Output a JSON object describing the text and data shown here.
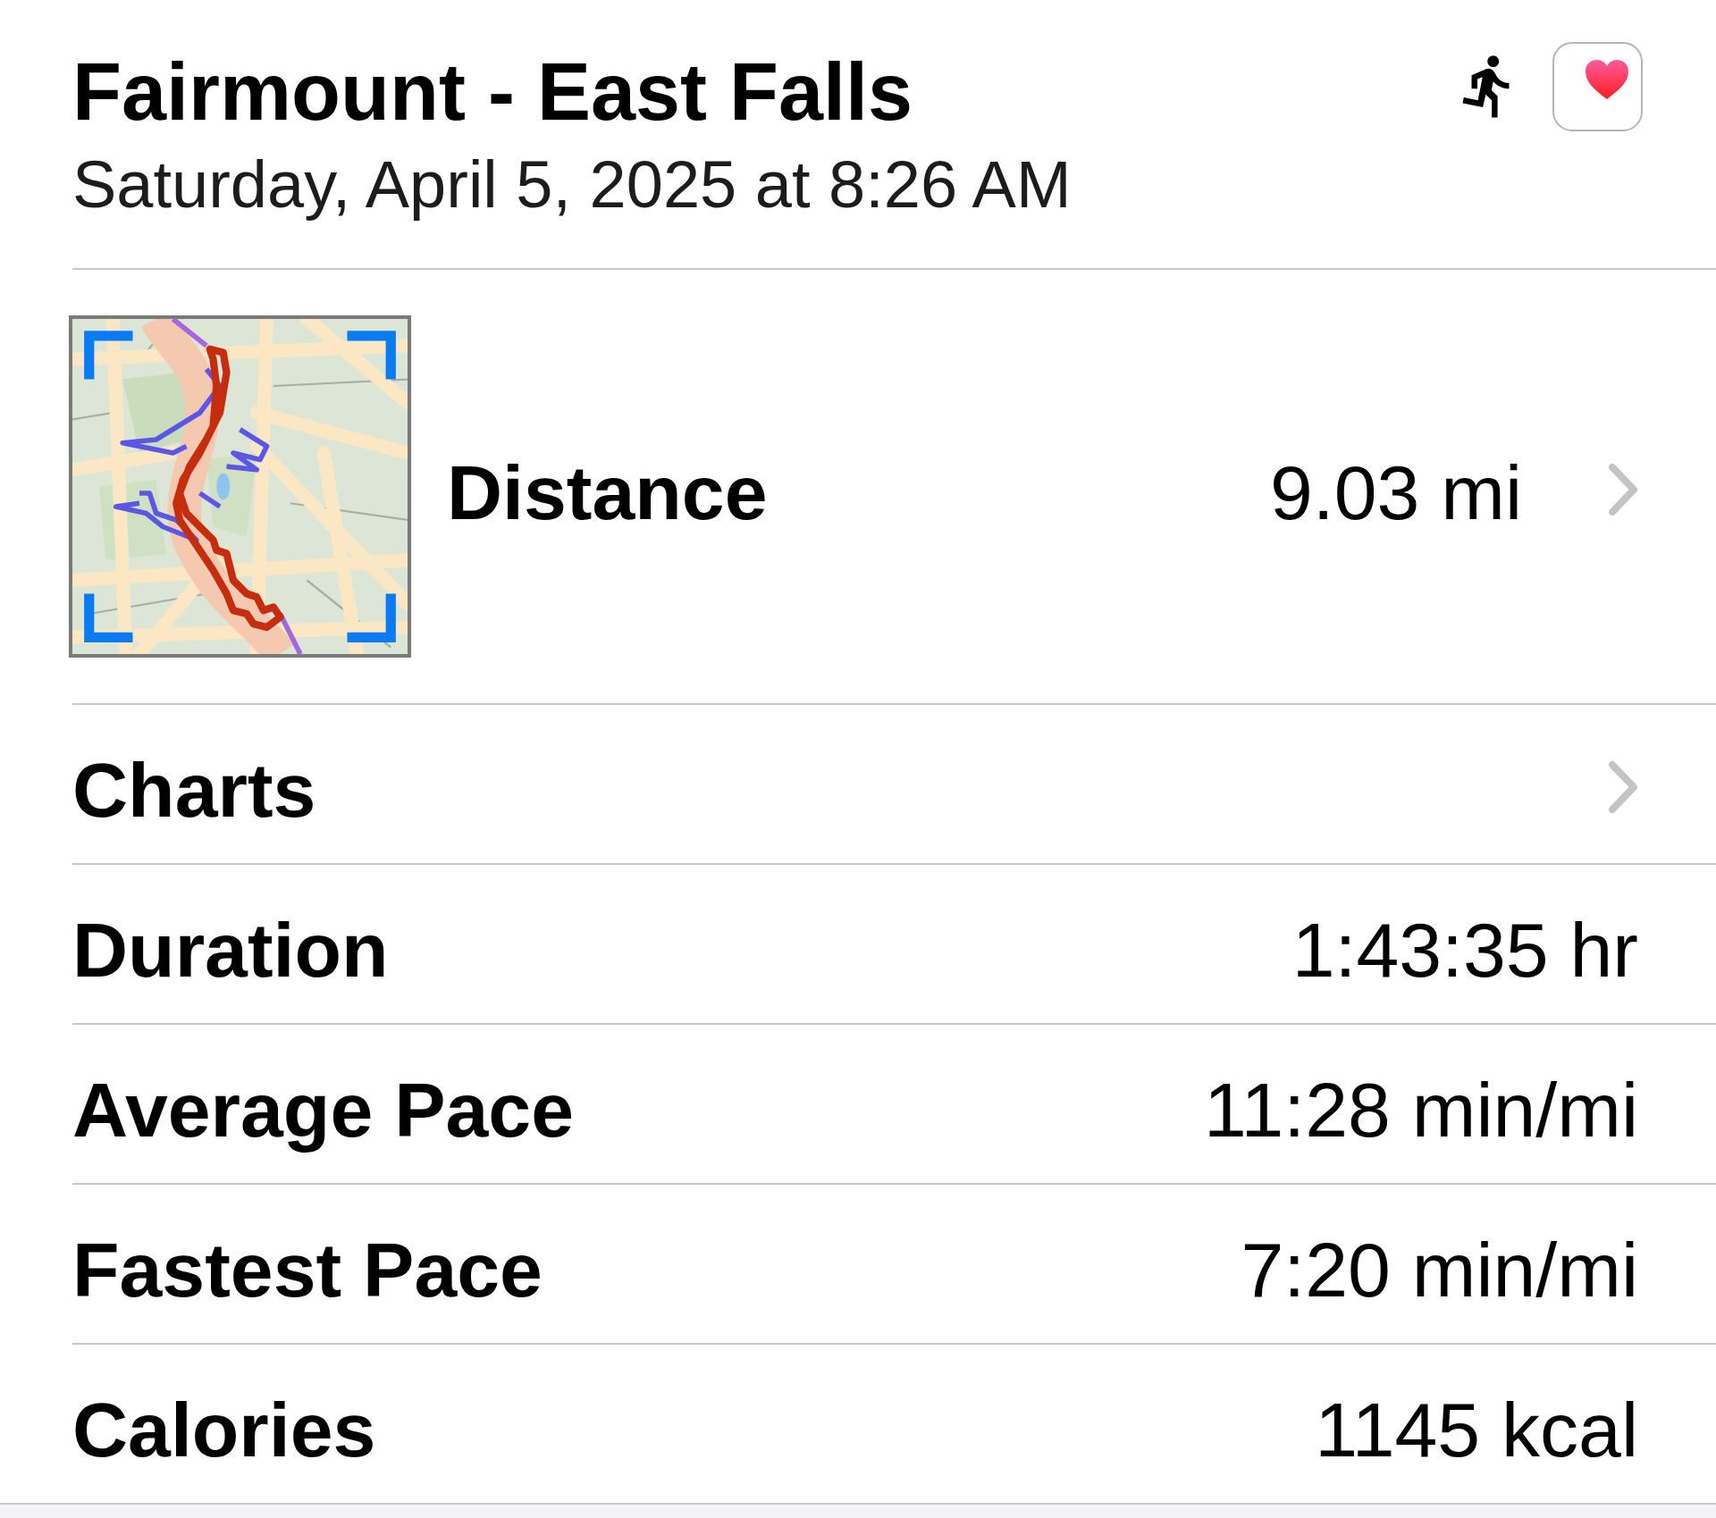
{
  "header": {
    "title": "Fairmount - East Falls",
    "subtitle": "Saturday, April 5, 2025 at 8:26 AM"
  },
  "rows": [
    {
      "kind": "map",
      "label": "Distance",
      "value": "9.03 mi"
    },
    {
      "kind": "link",
      "label": "Charts"
    },
    {
      "kind": "stat",
      "label": "Duration",
      "value": "1:43:35 hr"
    },
    {
      "kind": "stat",
      "label": "Average Pace",
      "value": "11:28 min/mi"
    },
    {
      "kind": "stat",
      "label": "Fastest Pace",
      "value": "7:20 min/mi"
    },
    {
      "kind": "stat",
      "label": "Calories",
      "value": "1145 kcal"
    }
  ]
}
